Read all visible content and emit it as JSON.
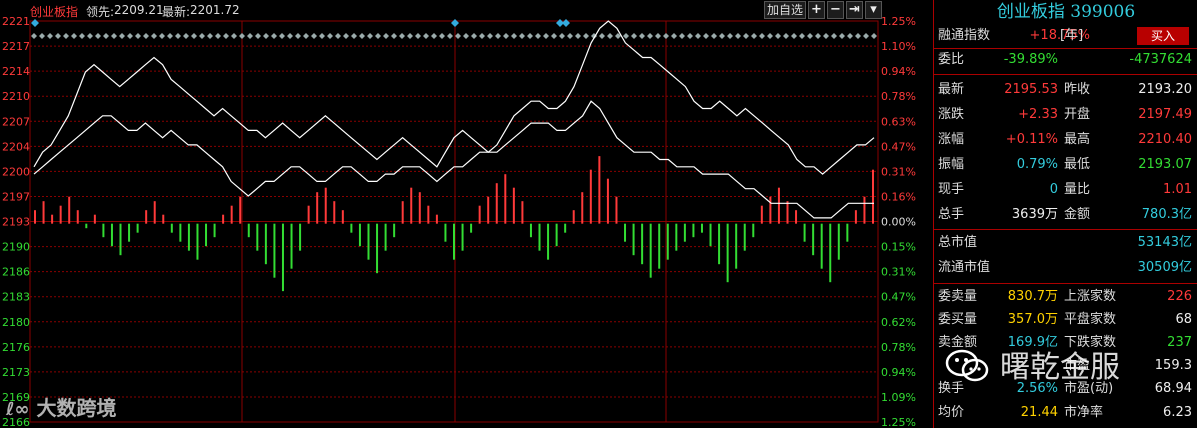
{
  "header": {
    "title": "创业板指",
    "lead_label": "领先:",
    "lead_value": "2209.21",
    "last_label": "最新:",
    "last_value": "2201.72",
    "add_button": "加自选",
    "tool_plus": "+",
    "tool_minus": "−",
    "tool_next": "⇥",
    "tool_menu": "▾"
  },
  "panel": {
    "title": "创业板指 399006",
    "buy_button": "买入",
    "rows": [
      {
        "l1": "融通指数",
        "v1": "+18.75%",
        "v1_suffix": "[年]",
        "v1c": "red"
      },
      {
        "l1": "委比",
        "v1": "-39.89%",
        "v1c": "green",
        "v2": "-4737624",
        "v2c": "green"
      },
      {
        "l1": "最新",
        "v1": "2195.53",
        "v1c": "red",
        "l2": "昨收",
        "v2": "2193.20",
        "v2c": "white"
      },
      {
        "l1": "涨跌",
        "v1": "+2.33",
        "v1c": "red",
        "l2": "开盘",
        "v2": "2197.49",
        "v2c": "red"
      },
      {
        "l1": "涨幅",
        "v1": "+0.11%",
        "v1c": "red",
        "l2": "最高",
        "v2": "2210.40",
        "v2c": "red"
      },
      {
        "l1": "振幅",
        "v1": "0.79%",
        "v1c": "cyan",
        "l2": "最低",
        "v2": "2193.07",
        "v2c": "green"
      },
      {
        "l1": "现手",
        "v1": "0",
        "v1c": "cyan",
        "l2": "量比",
        "v2": "1.01",
        "v2c": "red"
      },
      {
        "l1": "总手",
        "v1": "3639万",
        "v1c": "white",
        "l2": "金额",
        "v2": "780.3亿",
        "v2c": "cyan"
      },
      {
        "l1": "总市值",
        "v2": "53143亿",
        "v2c": "cyan"
      },
      {
        "l1": "流通市值",
        "v2": "30509亿",
        "v2c": "cyan"
      },
      {
        "l1": "委卖量",
        "v1": "830.7万",
        "v1c": "yellow",
        "l2": "上涨家数",
        "v2": "226",
        "v2c": "red"
      },
      {
        "l1": "委买量",
        "v1": "357.0万",
        "v1c": "yellow",
        "l2": "平盘家数",
        "v2": "68",
        "v2c": "white"
      },
      {
        "l1": "卖金额",
        "v1": "169.9亿",
        "v1c": "cyan",
        "l2": "下跌家数",
        "v2": "237",
        "v2c": "green"
      },
      {
        "l1": "",
        "v1": "",
        "v1c": "white",
        "l2": "市盈",
        "v2": "159.3",
        "v2c": "white"
      },
      {
        "l1": "换手",
        "v1": "2.56%",
        "v1c": "cyan",
        "l2": "市盈(动)",
        "v2": "68.94",
        "v2c": "white"
      },
      {
        "l1": "均价",
        "v1": "21.44",
        "v1c": "yellow",
        "l2": "市净率",
        "v2": "6.23",
        "v2c": "white"
      }
    ]
  },
  "watermarks": {
    "left": "大数跨境",
    "right": "曙乾金服"
  },
  "chart_data": {
    "type": "line",
    "y_left_ticks": [
      "2221",
      "2217",
      "2214",
      "2210",
      "2207",
      "2204",
      "2200",
      "2197",
      "2193",
      "2190",
      "2186",
      "2183",
      "2180",
      "2176",
      "2173",
      "2169",
      "2166"
    ],
    "y_right_ticks": [
      "1.25%",
      "1.10%",
      "0.94%",
      "0.78%",
      "0.63%",
      "0.47%",
      "0.31%",
      "0.16%",
      "0.00%",
      "0.15%",
      "0.31%",
      "0.47%",
      "0.62%",
      "0.78%",
      "0.94%",
      "1.09%",
      "1.25%"
    ],
    "ylim": [
      2166,
      2221
    ],
    "base": 2193.2,
    "colors": {
      "up": "#ff3a3a",
      "down": "#33dd33",
      "line": "#ffffff",
      "grid": "#8a0000",
      "axis_up": "#ff3a3a",
      "axis_down": "#33dd33"
    },
    "series": [
      {
        "values": [
          2201,
          2203,
          2204,
          2206,
          2208,
          2211,
          2214,
          2215,
          2214,
          2213,
          2212,
          2213,
          2214,
          2215,
          2216,
          2215,
          2213,
          2212,
          2211,
          2210,
          2209,
          2208,
          2209,
          2208,
          2207,
          2206,
          2206,
          2205,
          2206,
          2207,
          2206,
          2205,
          2206,
          2207,
          2208,
          2207,
          2206,
          2205,
          2204,
          2203,
          2202,
          2203,
          2204,
          2205,
          2204,
          2203,
          2202,
          2201,
          2203,
          2205,
          2206,
          2205,
          2204,
          2203,
          2204,
          2206,
          2208,
          2209,
          2210,
          2210,
          2209,
          2209,
          2210,
          2212,
          2215,
          2218,
          2220,
          2221,
          2220,
          2218,
          2217,
          2216,
          2216,
          2215,
          2214,
          2213,
          2212,
          2210,
          2209,
          2209,
          2210,
          2209,
          2208,
          2209,
          2208,
          2207,
          2206,
          2205,
          2204,
          2202,
          2201,
          2201,
          2200,
          2201,
          2202,
          2203,
          2204,
          2204,
          2205
        ]
      },
      {
        "values": [
          2200,
          2201,
          2202,
          2203,
          2204,
          2205,
          2206,
          2207,
          2208,
          2208,
          2207,
          2206,
          2206,
          2207,
          2206,
          2205,
          2206,
          2205,
          2204,
          2204,
          2203,
          2202,
          2201,
          2199,
          2198,
          2197,
          2198,
          2199,
          2199,
          2200,
          2201,
          2201,
          2200,
          2199,
          2199,
          2200,
          2201,
          2201,
          2200,
          2199,
          2199,
          2200,
          2200,
          2201,
          2201,
          2201,
          2200,
          2199,
          2200,
          2201,
          2201,
          2202,
          2203,
          2203,
          2203,
          2204,
          2205,
          2206,
          2207,
          2207,
          2207,
          2206,
          2206,
          2207,
          2208,
          2210,
          2209,
          2207,
          2205,
          2204,
          2203,
          2203,
          2203,
          2202,
          2202,
          2201,
          2201,
          2201,
          2200,
          2200,
          2200,
          2200,
          2199,
          2198,
          2198,
          2197,
          2196,
          2196,
          2196,
          2196,
          2195,
          2194,
          2194,
          2194,
          2195,
          2196,
          2196,
          2196,
          2196
        ]
      }
    ],
    "volume": [
      3,
      5,
      2,
      4,
      6,
      3,
      -1,
      2,
      -3,
      -5,
      -7,
      -4,
      -2,
      3,
      5,
      2,
      -2,
      -4,
      -6,
      -8,
      -5,
      -3,
      2,
      4,
      6,
      -3,
      -6,
      -9,
      -12,
      -15,
      -10,
      -6,
      4,
      7,
      8,
      5,
      3,
      -2,
      -5,
      -8,
      -11,
      -6,
      -3,
      5,
      8,
      7,
      4,
      2,
      -4,
      -8,
      -6,
      -2,
      4,
      6,
      9,
      11,
      8,
      5,
      -3,
      -6,
      -8,
      -5,
      -2,
      3,
      7,
      12,
      15,
      10,
      6,
      -4,
      -7,
      -9,
      -12,
      -10,
      -8,
      -6,
      -4,
      -3,
      -2,
      -5,
      -9,
      -13,
      -10,
      -6,
      -3,
      4,
      6,
      8,
      5,
      3,
      -4,
      -7,
      -10,
      -13,
      -8,
      -4,
      3,
      6,
      12
    ]
  }
}
